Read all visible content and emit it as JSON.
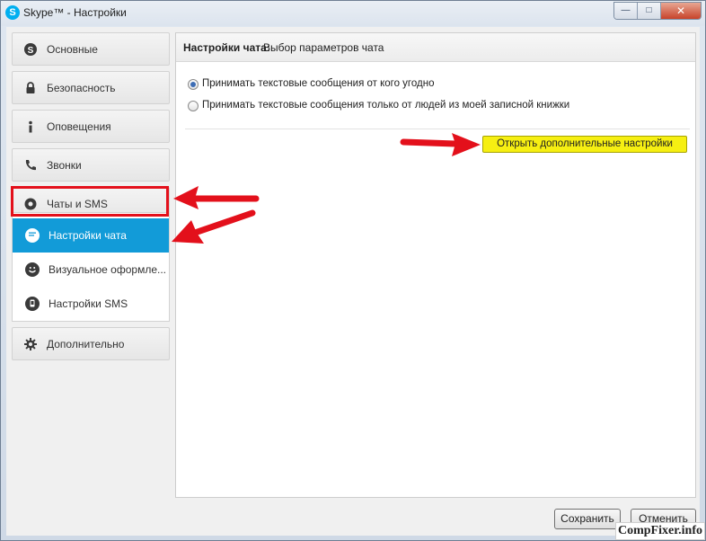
{
  "window": {
    "title": "Skype™ - Настройки",
    "app_icon": "S",
    "controls": {
      "minimize": "—",
      "maximize": "□",
      "close": "✕"
    }
  },
  "sidebar": {
    "items": [
      {
        "label": "Основные",
        "icon": "skype-icon"
      },
      {
        "label": "Безопасность",
        "icon": "lock-icon"
      },
      {
        "label": "Оповещения",
        "icon": "info-icon"
      },
      {
        "label": "Звонки",
        "icon": "phone-icon"
      },
      {
        "label": "Чаты и SMS",
        "icon": "chat-gear-icon"
      }
    ],
    "sub_items": [
      {
        "label": "Настройки чата",
        "icon": "chat-bubble-icon",
        "active": true
      },
      {
        "label": "Визуальное оформле...",
        "icon": "smiley-icon",
        "active": false
      },
      {
        "label": "Настройки SMS",
        "icon": "sms-icon",
        "active": false
      }
    ],
    "advanced": {
      "label": "Дополнительно",
      "icon": "gear-icon"
    }
  },
  "content": {
    "header_main": "Настройки чата:",
    "header_sub": "Выбор параметров чата",
    "options": [
      {
        "label": "Принимать текстовые сообщения от кого угодно",
        "checked": true
      },
      {
        "label": "Принимать текстовые сообщения только от людей из моей записной книжки",
        "checked": false
      }
    ],
    "advanced_button": "Открыть дополнительные настройки"
  },
  "footer": {
    "save": "Сохранить",
    "cancel": "Отменить"
  },
  "watermark": "CompFixer.info",
  "colors": {
    "active_item": "#129bd8",
    "highlight_button": "#f6ef12",
    "annotation_red": "#e3101b"
  }
}
